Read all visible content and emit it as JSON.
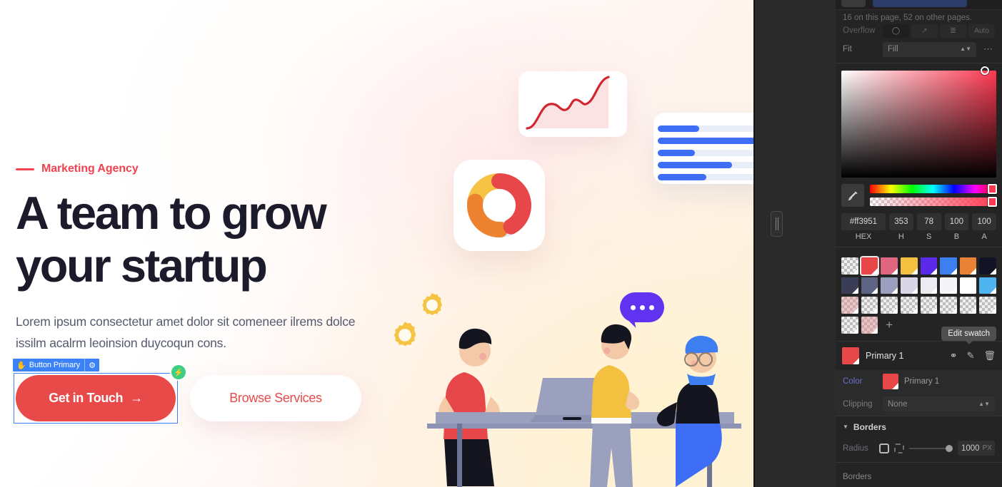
{
  "canvas": {
    "hero": {
      "eyebrow": "Marketing Agency",
      "title_line1": "A team to grow",
      "title_line2": "your startup",
      "subtitle": "Lorem ipsum consectetur amet dolor sit comeneer ilrems dolce issilm acalrm leoinsion duycoqun cons.",
      "primary_button": "Get in Touch",
      "primary_button_arrow": "→",
      "secondary_button": "Browse Services",
      "accent_color": "#e84a49",
      "title_color": "#1b1b2b"
    },
    "selection": {
      "label": "Button Primary",
      "hand_icon": "hand-cursor-icon",
      "gear_icon": "gear-icon",
      "badge_icon": "lightning-bolt-icon",
      "badge_color": "#3dce86",
      "outline_color": "#3b82f6"
    },
    "bars_card": {
      "fills": [
        60,
        100,
        54,
        82,
        66
      ],
      "fill_color": "#3d6ef5",
      "track_color": "#e8edf7"
    },
    "donut_card": {
      "segments": [
        {
          "name": "red",
          "color": "#e8474a",
          "value": 42
        },
        {
          "name": "orange",
          "color": "#ed8231",
          "value": 28
        },
        {
          "name": "yellow",
          "color": "#f6c445",
          "value": 22
        },
        {
          "name": "grey",
          "color": "#e6e9ef",
          "value": 8
        }
      ]
    },
    "line_card": {
      "line_color": "#d32530",
      "fill_color": "#fbe3e4"
    }
  },
  "gutter": {
    "handle_name": "canvas-resize-handle"
  },
  "panel": {
    "pages_note": "16 on this page, 52 on other pages.",
    "overflow": {
      "label": "Overflow",
      "options": [
        "visible",
        "scroll",
        "hidden",
        "Auto"
      ],
      "active_index": 0
    },
    "fit": {
      "label": "Fit",
      "value": "Fill",
      "more_icon": "ellipsis-icon"
    },
    "color_picker": {
      "eyedropper_icon": "eyedropper-icon",
      "hex_value": "#ff3951",
      "h_value": "353",
      "s_value": "78",
      "b_value": "100",
      "a_value": "100",
      "label_hex": "HEX",
      "label_h": "H",
      "label_s": "S",
      "label_b": "B",
      "label_a": "A",
      "current_color": "#ff3951"
    },
    "swatches": {
      "add_icon": "plus-icon",
      "tooltip": "Edit swatch",
      "selected_index": 1,
      "items": [
        {
          "color": "transparent",
          "name": "transparent"
        },
        {
          "color": "#e8474a",
          "name": "red"
        },
        {
          "color": "#e0657f",
          "name": "pink"
        },
        {
          "color": "#f3c13f",
          "name": "yellow"
        },
        {
          "color": "#5a2ae8",
          "name": "violet"
        },
        {
          "color": "#3d7ef0",
          "name": "blue"
        },
        {
          "color": "#ea8235",
          "name": "orange"
        },
        {
          "color": "#131326",
          "name": "near-black"
        },
        {
          "color": "#3b3d56",
          "name": "dark-navy"
        },
        {
          "color": "#5d6383",
          "name": "slate"
        },
        {
          "color": "#9aa0bd",
          "name": "light-slate"
        },
        {
          "color": "#d9d7e6",
          "name": "lavender"
        },
        {
          "color": "#ecebf2",
          "name": "pale-lavender"
        },
        {
          "color": "#f5f4f8",
          "name": "off-white"
        },
        {
          "color": "#ffffff",
          "name": "white"
        },
        {
          "color": "#4fb3f0",
          "name": "sky-blue"
        },
        {
          "color": "rgba(224,148,148,0.45)",
          "name": "faded-rose"
        },
        {
          "color": "transparent",
          "name": "transparent"
        },
        {
          "color": "transparent",
          "name": "transparent"
        },
        {
          "color": "transparent",
          "name": "transparent"
        },
        {
          "color": "transparent",
          "name": "transparent"
        },
        {
          "color": "transparent",
          "name": "transparent"
        },
        {
          "color": "transparent",
          "name": "transparent"
        },
        {
          "color": "transparent",
          "name": "transparent"
        },
        {
          "color": "transparent",
          "name": "transparent"
        },
        {
          "color": "rgba(226,150,150,0.5)",
          "name": "faded-rose-2"
        }
      ]
    },
    "primary_token": {
      "name": "Primary 1",
      "color": "#e8474a",
      "unlink_icon": "unlink-icon",
      "edit_icon": "pencil-icon",
      "delete_icon": "trash-icon"
    },
    "color_row": {
      "label": "Color",
      "value": "Primary 1",
      "swatch_color": "#e8474a"
    },
    "clipping_row": {
      "label": "Clipping",
      "value": "None"
    },
    "borders_section": {
      "title": "Borders",
      "caret_icon": "caret-down-icon",
      "radius_label": "Radius",
      "radius_value": "1000",
      "radius_unit": "PX",
      "uniform_icon": "rounded-square-icon",
      "individual_icon": "corners-icon",
      "borders_label": "Borders"
    }
  }
}
